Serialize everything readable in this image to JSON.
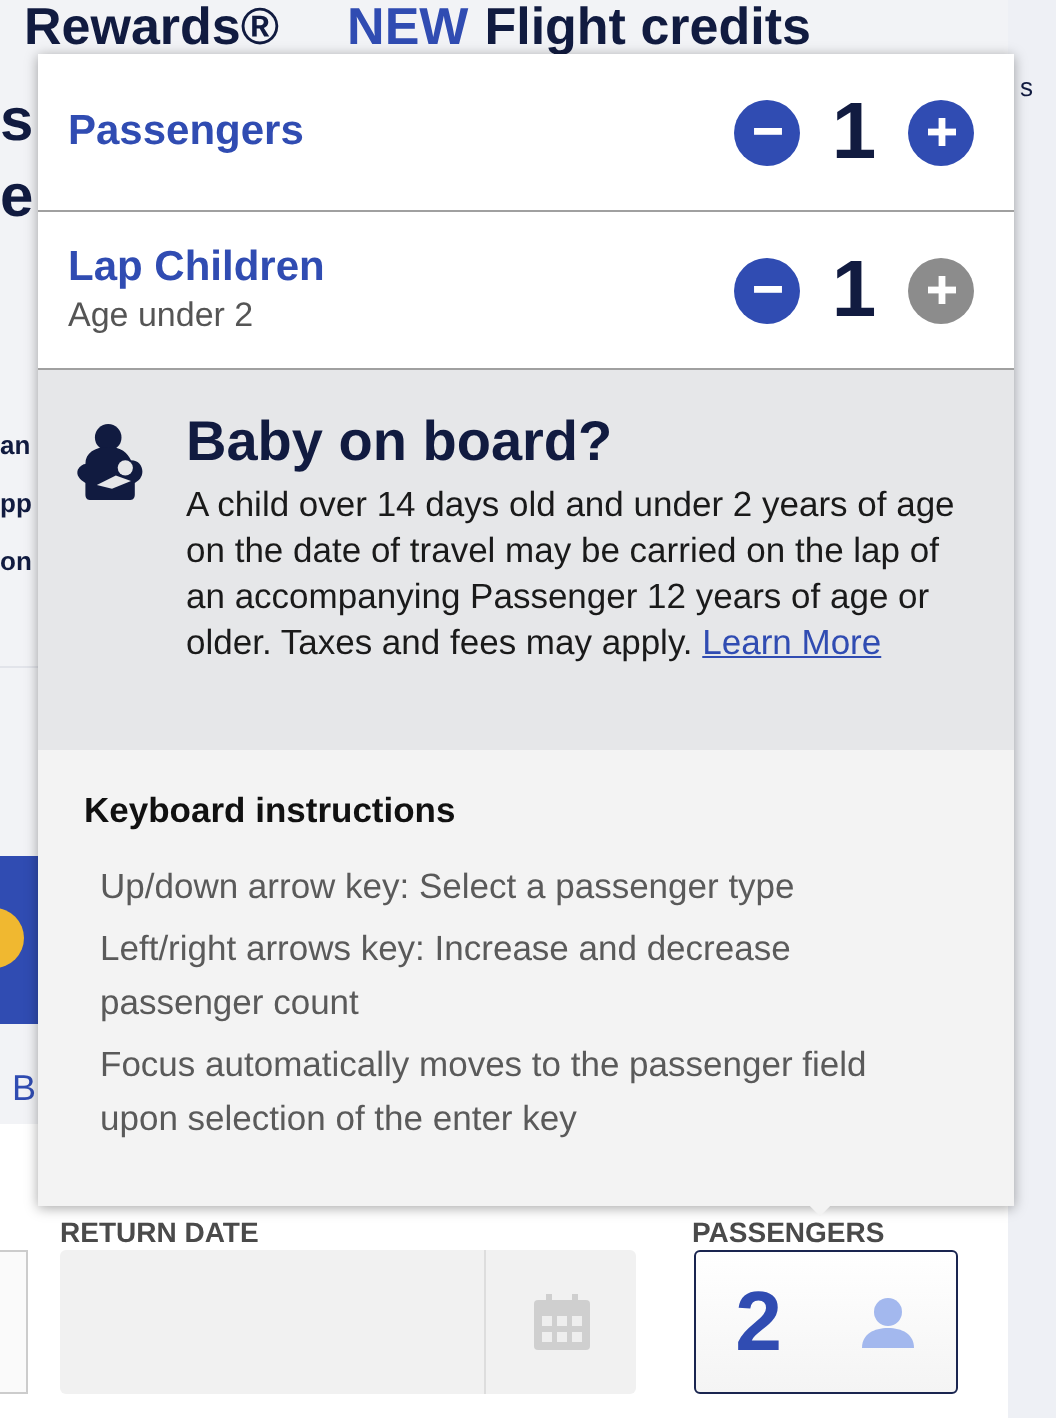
{
  "background": {
    "heading": "Rewards®",
    "promo_badge": "NEW",
    "promo_text": "Flight credits",
    "side_fragment": "s",
    "heading_fragments": [
      "s",
      "e"
    ],
    "text_fragments": [
      "an",
      "pp",
      "on"
    ],
    "link_fragment": "B",
    "return_label": "RETURN DATE",
    "passengers_label": "PASSENGERS",
    "passengers_value": "2"
  },
  "popup": {
    "rows": [
      {
        "label": "Passengers",
        "count": "1",
        "minus_disabled": false,
        "plus_disabled": false
      },
      {
        "label": "Lap Children",
        "sublabel": "Age under 2",
        "count": "1",
        "minus_disabled": false,
        "plus_disabled": true
      }
    ],
    "notice": {
      "title": "Baby on board?",
      "text": "A child over 14 days old and under 2 years of age on the date of travel may be carried on the lap of an accompanying Passenger 12 years of age or older. Taxes and fees may apply.",
      "link": "Learn More"
    },
    "keyboard": {
      "title": "Keyboard instructions",
      "items": [
        "Up/down arrow key: Select a passenger type",
        "Left/right arrows key: Increase and decrease passenger count",
        "Focus automatically moves to the passenger field upon selection of the enter key"
      ]
    }
  }
}
